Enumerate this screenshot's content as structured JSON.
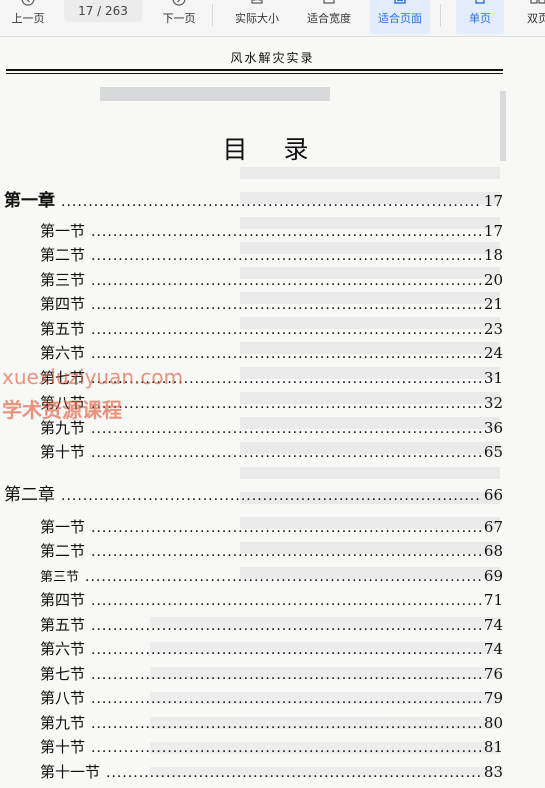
{
  "toolbar": {
    "prev_label": "上一页",
    "page_indicator": "17 / 263",
    "next_label": "下一页",
    "actual_size_label": "实际大小",
    "fit_width_label": "适合宽度",
    "fit_page_label": "适合页面",
    "single_page_label": "单页",
    "double_page_label": "双页"
  },
  "page": {
    "running_header": "风水解灾实录",
    "toc_title": "目 录",
    "chapters": [
      {
        "label": "第一章",
        "page": "17",
        "sections": [
          {
            "label": "第一节",
            "page": "17"
          },
          {
            "label": "第二节",
            "page": "18"
          },
          {
            "label": "第三节",
            "page": "20"
          },
          {
            "label": "第四节",
            "page": "21"
          },
          {
            "label": "第五节",
            "page": "23"
          },
          {
            "label": "第六节",
            "page": "24"
          },
          {
            "label": "第七节",
            "page": "31"
          },
          {
            "label": "第八节",
            "page": "32"
          },
          {
            "label": "第九节",
            "page": "36"
          },
          {
            "label": "第十节",
            "page": "65"
          }
        ]
      },
      {
        "label": "第二章",
        "page": "66",
        "sections": [
          {
            "label": "第一节",
            "page": "67"
          },
          {
            "label": "第二节",
            "page": "68"
          },
          {
            "label": "第三节",
            "page": "69"
          },
          {
            "label": "第四节",
            "page": "71"
          },
          {
            "label": "第五节",
            "page": "74"
          },
          {
            "label": "第六节",
            "page": "74"
          },
          {
            "label": "第七节",
            "page": "76"
          },
          {
            "label": "第八节",
            "page": "79"
          },
          {
            "label": "第九节",
            "page": "80"
          },
          {
            "label": "第十节",
            "page": "81"
          },
          {
            "label": "第十一节",
            "page": "83"
          }
        ]
      }
    ],
    "watermark_line1": "xuexiuziyuan.com",
    "watermark_line2": "学术资源课程"
  }
}
